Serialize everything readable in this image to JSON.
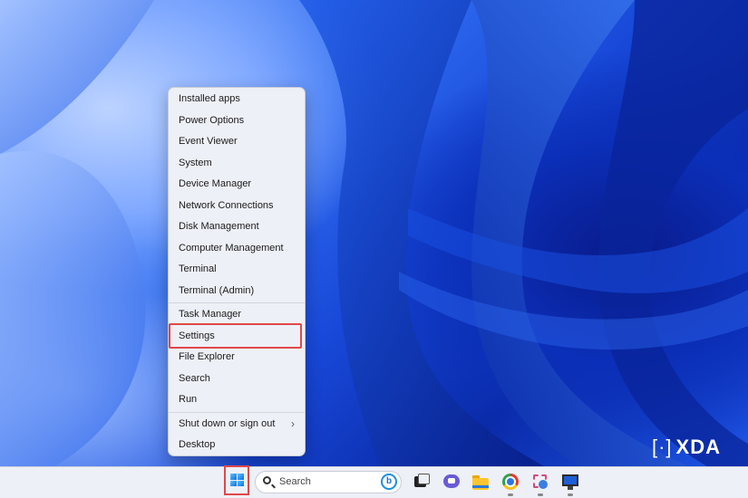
{
  "desktop": {
    "watermark": "XDA"
  },
  "context_menu": {
    "groups": [
      [
        "Installed apps",
        "Power Options",
        "Event Viewer",
        "System",
        "Device Manager",
        "Network Connections",
        "Disk Management",
        "Computer Management",
        "Terminal",
        "Terminal (Admin)"
      ],
      [
        "Task Manager",
        "Settings",
        "File Explorer",
        "Search",
        "Run"
      ],
      [
        "Shut down or sign out",
        "Desktop"
      ]
    ],
    "highlighted_item": "Settings",
    "highlight_color": "#e0484b"
  },
  "taskbar": {
    "search_placeholder": "Search",
    "bing_glyph": "b",
    "icons": [
      "start-windows-icon",
      "search-icon",
      "bing-icon",
      "task-view-icon",
      "teams-chat-icon",
      "file-explorer-folder-icon",
      "chrome-icon",
      "snipping-tool-icon",
      "remote-desktop-icon"
    ]
  }
}
